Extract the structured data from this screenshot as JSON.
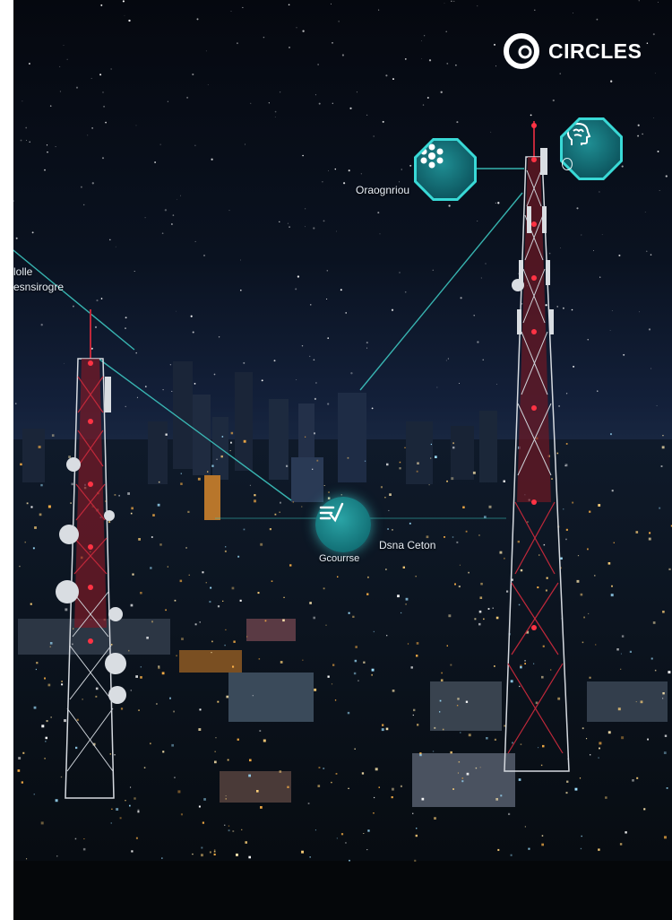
{
  "brand": {
    "name": "CIRCLES",
    "logo_icon": "circles-logo-icon"
  },
  "labels": {
    "top_node_label": "Oraognriou",
    "left_label_line1": "lolle",
    "left_label_line2": "esnsirogre",
    "center_node_label_right": "Dsna Ceton",
    "center_node_label_below": "Gcourrse"
  },
  "icons": {
    "top_node": "network-nodes-icon",
    "right_node": "brain-head-icon",
    "center_node": "sliders-check-icon"
  },
  "colors": {
    "accent_teal": "#39d9d6",
    "tower_red": "#c0283a",
    "sky": "#05080f"
  }
}
